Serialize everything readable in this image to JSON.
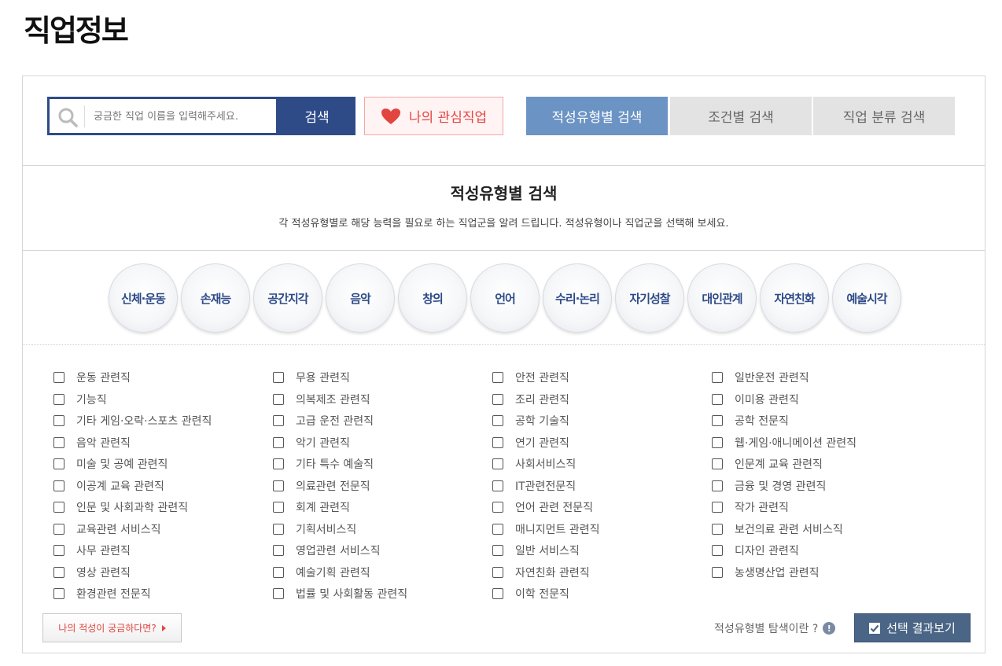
{
  "page": {
    "title": "직업정보"
  },
  "topbar": {
    "search_placeholder": "궁금한 직업 이름을 입력해주세요.",
    "search_button": "검색",
    "favorites_button": "나의 관심직업",
    "tabs": [
      {
        "label": "적성유형별 검색",
        "active": true
      },
      {
        "label": "조건별 검색",
        "active": false
      },
      {
        "label": "직업 분류 검색",
        "active": false
      }
    ]
  },
  "intro": {
    "title": "적성유형별 검색",
    "description": "각 적성유형별로 해당 능력을 필요로 하는 직업군을 알려 드립니다. 적성유형이나 직업군을 선택해 보세요."
  },
  "aptitude_types": [
    "신체·운동",
    "손재능",
    "공간지각",
    "음악",
    "창의",
    "언어",
    "수리·논리",
    "자기성찰",
    "대인관계",
    "자연친화",
    "예술시각"
  ],
  "job_groups": [
    [
      "운동 관련직",
      "기능직",
      "기타 게임·오락·스포츠 관련직",
      "음악 관련직",
      "미술 및 공예 관련직",
      "이공계 교육 관련직",
      "인문 및 사회과학 관련직",
      "교육관련 서비스직",
      "사무 관련직",
      "영상 관련직",
      "환경관련 전문직"
    ],
    [
      "무용 관련직",
      "의복제조 관련직",
      "고급 운전 관련직",
      "악기 관련직",
      "기타 특수 예술직",
      "의료관련 전문직",
      "회계 관련직",
      "기획서비스직",
      "영업관련 서비스직",
      "예술기획 관련직",
      "법률 및 사회활동 관련직"
    ],
    [
      "안전 관련직",
      "조리 관련직",
      "공학 기술직",
      "연기 관련직",
      "사회서비스직",
      "IT관련전문직",
      "언어 관련 전문직",
      "매니지먼트 관련직",
      "일반 서비스직",
      "자연친화 관련직",
      "이학 전문직"
    ],
    [
      "일반운전 관련직",
      "이미용 관련직",
      "공학 전문직",
      "웹·게임·애니메이션 관련직",
      "인문계 교육 관련직",
      "금융 및 경영 관련직",
      "작가 관련직",
      "보건의료 관련 서비스직",
      "디자인 관련직",
      "농생명산업 관련직"
    ]
  ],
  "footer": {
    "aptitude_button": "나의 적성이 궁금하다면?",
    "help_text": "적성유형별 탐색이란 ?",
    "result_button": "선택 결과보기"
  },
  "colors": {
    "primary": "#2e4b88",
    "active_tab": "#6b93c4",
    "accent_red": "#e2453f",
    "result_button": "#4a6585"
  }
}
